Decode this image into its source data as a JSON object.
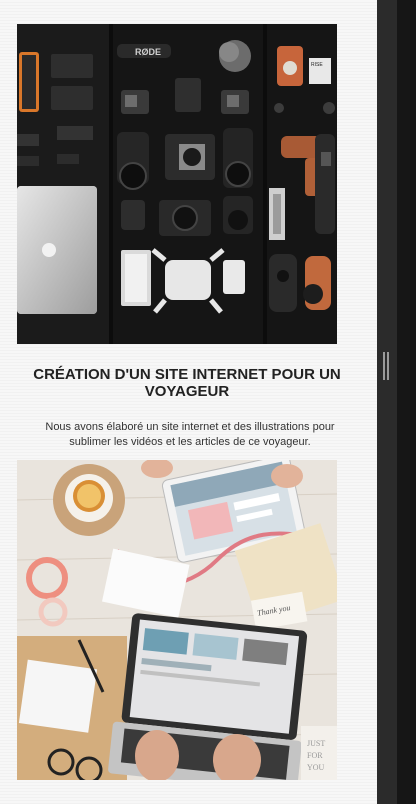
{
  "project": {
    "title": "CRÉATION D'UN SITE INTERNET POUR UN VOYAGEUR",
    "description": "Nous avons élaboré un site internet et des illustrations pour sublimer les vidéos et les articles de ce voyageur."
  },
  "image1": {
    "icon": "camera-gear-flatlay-photo",
    "embedded_text": [
      "RØDE",
      "RISE Filmmaker"
    ]
  },
  "image2": {
    "icon": "laptop-desk-flatlay-photo",
    "embedded_text": [
      "Thank you",
      "JUST FOR YOU"
    ]
  },
  "colors": {
    "page_bg": "#f7f7f7",
    "title": "#222222",
    "text": "#333333",
    "dark_gutter": "#2b2b2b"
  }
}
